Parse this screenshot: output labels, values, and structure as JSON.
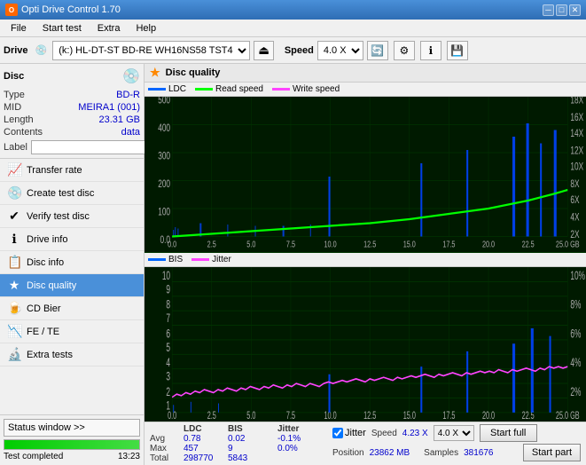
{
  "app": {
    "title": "Opti Drive Control 1.70",
    "icon_label": "O"
  },
  "title_controls": {
    "minimize": "─",
    "maximize": "□",
    "close": "✕"
  },
  "menu": {
    "items": [
      "File",
      "Start test",
      "Extra",
      "Help"
    ]
  },
  "drive_bar": {
    "drive_label": "Drive",
    "drive_value": "(k:)  HL-DT-ST BD-RE  WH16NS58 TST4",
    "speed_label": "Speed",
    "speed_value": "4.0 X"
  },
  "disc": {
    "title": "Disc",
    "type_label": "Type",
    "type_value": "BD-R",
    "mid_label": "MID",
    "mid_value": "MEIRA1 (001)",
    "length_label": "Length",
    "length_value": "23.31 GB",
    "contents_label": "Contents",
    "contents_value": "data",
    "label_label": "Label"
  },
  "nav_items": [
    {
      "id": "transfer-rate",
      "label": "Transfer rate",
      "icon": "📈"
    },
    {
      "id": "create-test-disc",
      "label": "Create test disc",
      "icon": "💿"
    },
    {
      "id": "verify-test-disc",
      "label": "Verify test disc",
      "icon": "✔"
    },
    {
      "id": "drive-info",
      "label": "Drive info",
      "icon": "ℹ"
    },
    {
      "id": "disc-info",
      "label": "Disc info",
      "icon": "📋"
    },
    {
      "id": "disc-quality",
      "label": "Disc quality",
      "icon": "★",
      "active": true
    },
    {
      "id": "cd-bier",
      "label": "CD Bier",
      "icon": "🍺"
    },
    {
      "id": "fe-te",
      "label": "FE / TE",
      "icon": "📉"
    },
    {
      "id": "extra-tests",
      "label": "Extra tests",
      "icon": "🔬"
    }
  ],
  "status": {
    "btn_label": "Status window >>",
    "progress_pct": 100,
    "status_text": "Test completed",
    "time": "13:23"
  },
  "disc_quality_title": "Disc quality",
  "legend_top": {
    "ldc": "LDC",
    "read": "Read speed",
    "write": "Write speed"
  },
  "legend_bottom": {
    "bis": "BIS",
    "jitter": "Jitter"
  },
  "chart1": {
    "y_labels_left": [
      "500",
      "400",
      "300",
      "200",
      "100",
      "0.0"
    ],
    "y_labels_right": [
      "18X",
      "16X",
      "14X",
      "12X",
      "10X",
      "8X",
      "6X",
      "4X",
      "2X"
    ],
    "x_labels": [
      "0.0",
      "2.5",
      "5.0",
      "7.5",
      "10.0",
      "12.5",
      "15.0",
      "17.5",
      "20.0",
      "22.5",
      "25.0 GB"
    ]
  },
  "chart2": {
    "y_labels_left": [
      "10",
      "9",
      "8",
      "7",
      "6",
      "5",
      "4",
      "3",
      "2",
      "1"
    ],
    "y_labels_right": [
      "10%",
      "8%",
      "6%",
      "4%",
      "2%"
    ],
    "x_labels": [
      "0.0",
      "2.5",
      "5.0",
      "7.5",
      "10.0",
      "12.5",
      "15.0",
      "17.5",
      "20.0",
      "22.5",
      "25.0 GB"
    ]
  },
  "stats": {
    "col_headers": [
      "",
      "LDC",
      "BIS",
      "",
      "Jitter",
      "Speed",
      ""
    ],
    "rows": [
      {
        "label": "Avg",
        "ldc": "0.78",
        "bis": "0.02",
        "jitter": "-0.1%",
        "color": "blue"
      },
      {
        "label": "Max",
        "ldc": "457",
        "bis": "9",
        "jitter": "0.0%",
        "color": "blue"
      },
      {
        "label": "Total",
        "ldc": "298770",
        "bis": "5843",
        "jitter": "",
        "color": "blue"
      }
    ],
    "jitter_checked": true,
    "jitter_label": "Jitter",
    "speed_label": "Speed",
    "speed_value": "4.23 X",
    "speed_select": "4.0 X",
    "position_label": "Position",
    "position_value": "23862 MB",
    "samples_label": "Samples",
    "samples_value": "381676",
    "start_full_label": "Start full",
    "start_part_label": "Start part"
  }
}
